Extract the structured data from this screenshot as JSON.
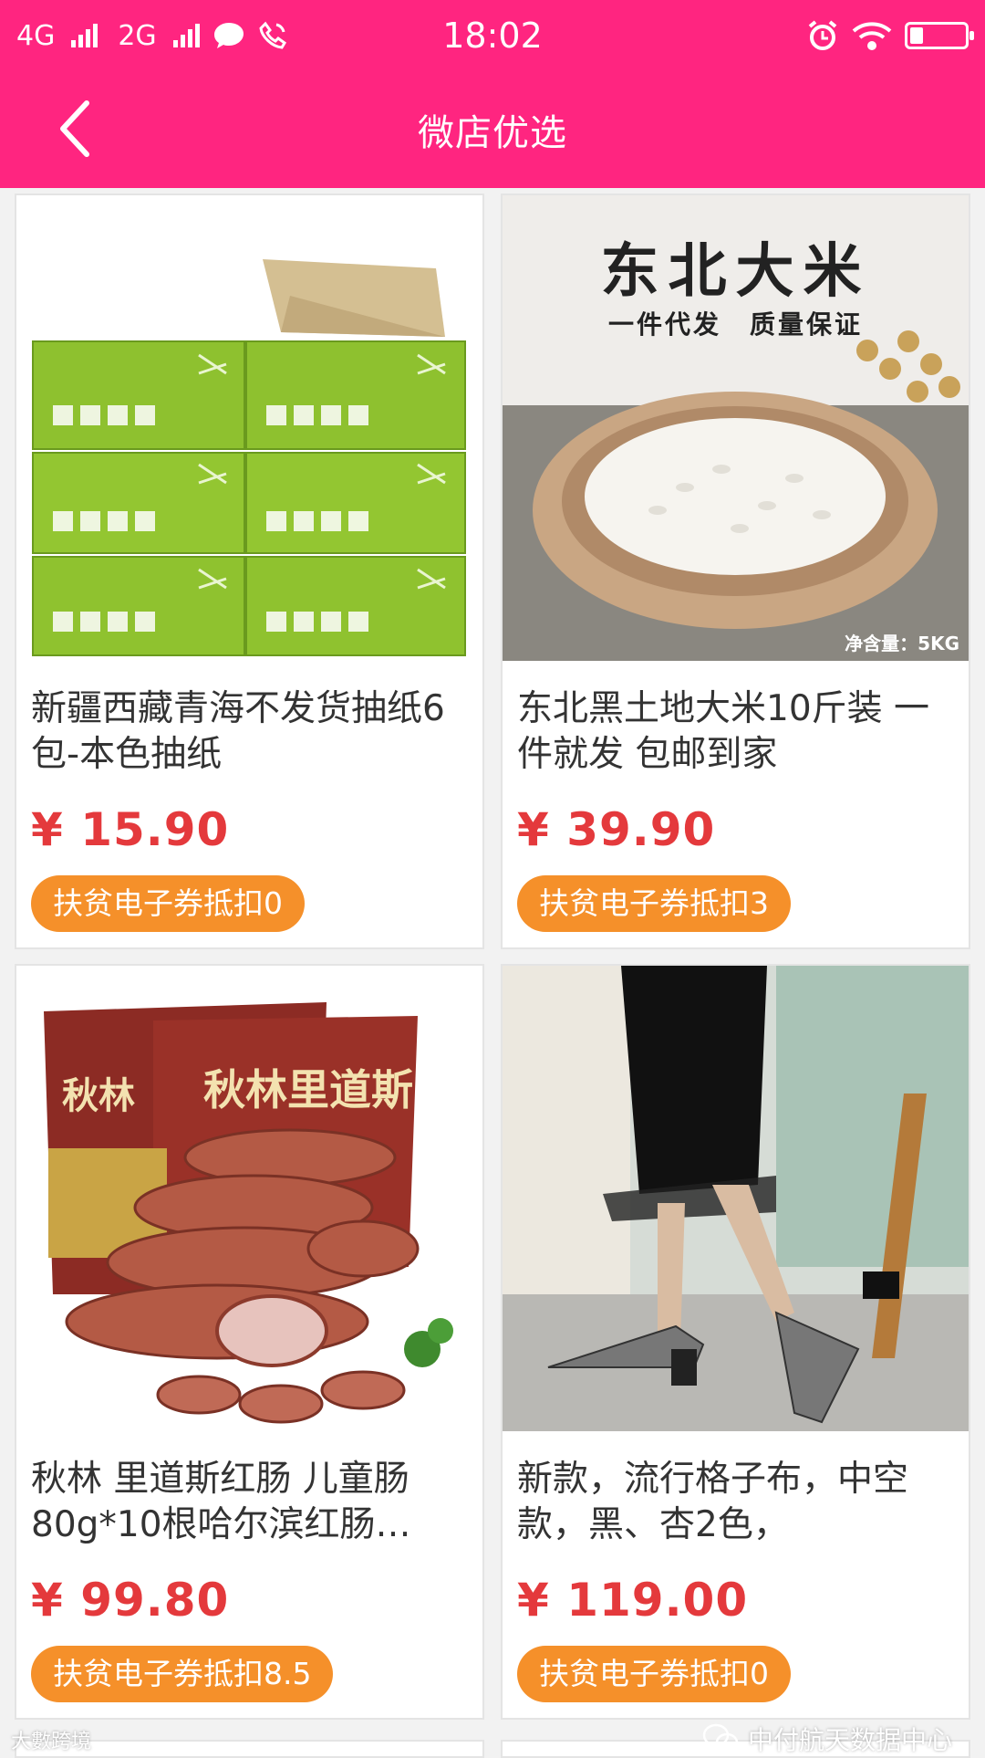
{
  "status_bar": {
    "network_1": "4G",
    "network_2": "2G",
    "time": "18:02",
    "icons": [
      "signal-icon",
      "chat-icon",
      "phone-icon",
      "alarm-icon",
      "wifi-icon",
      "battery-icon"
    ]
  },
  "nav": {
    "title": "微店优选",
    "back_icon": "back-arrow-icon",
    "color": "#ff2580"
  },
  "products": [
    {
      "name": "新疆西藏青海不发货抽纸6包-本色抽纸",
      "price": "¥ 15.90",
      "coupon": "扶贫电子券抵扣0",
      "image": "tissue-pack-image"
    },
    {
      "name": "东北黑土地大米10斤装 一件就发 包邮到家",
      "price": "¥ 39.90",
      "coupon": "扶贫电子券抵扣3",
      "image": "rice-bowl-image",
      "image_text": {
        "title": "东北大米",
        "subtitle": "一件代发　质量保证",
        "net": "净含量：5KG"
      }
    },
    {
      "name": "秋林 里道斯红肠 儿童肠80g*10根哈尔滨红肠…",
      "price": "¥ 99.80",
      "coupon": "扶贫电子券抵扣8.5",
      "image": "sausage-image",
      "image_text": {
        "brand": "秋林里道斯",
        "brand2": "秋林"
      }
    },
    {
      "name": "新款，流行格子布，中空款，黑、杏2色，",
      "price": "¥ 119.00",
      "coupon": "扶贫电子券抵扣0",
      "image": "shoes-image"
    }
  ],
  "watermark": {
    "text": "中付航天数据中心",
    "text2": "大數跨境"
  },
  "colors": {
    "price": "#e4393c",
    "coupon": "#f5902a"
  }
}
